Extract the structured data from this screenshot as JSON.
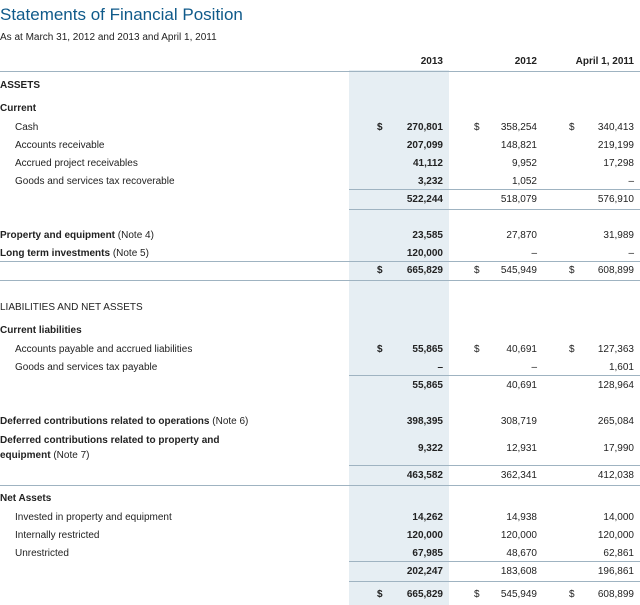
{
  "title": "Statements of Financial Position",
  "subtitle": "As at March 31, 2012 and 2013 and April 1, 2011",
  "columns": [
    "2013",
    "2012",
    "April 1, 2011"
  ],
  "currency_symbol": "$",
  "assets": {
    "heading": "ASSETS",
    "current_heading": "Current",
    "rows": [
      {
        "label": "Cash",
        "values": [
          "270,801",
          "358,254",
          "340,413"
        ]
      },
      {
        "label": "Accounts receivable",
        "values": [
          "207,099",
          "148,821",
          "219,199"
        ]
      },
      {
        "label": "Accrued project receivables",
        "values": [
          "41,112",
          "9,952",
          "17,298"
        ]
      },
      {
        "label": "Goods and services tax recoverable",
        "values": [
          "3,232",
          "1,052",
          "–"
        ]
      }
    ],
    "current_total": [
      "522,244",
      "518,079",
      "576,910"
    ],
    "property_label": "Property and equipment",
    "property_note": "(Note 4)",
    "property_values": [
      "23,585",
      "27,870",
      "31,989"
    ],
    "investments_label": "Long term investments",
    "investments_note": "(Note 5)",
    "investments_values": [
      "120,000",
      "–",
      "–"
    ],
    "total": [
      "665,829",
      "545,949",
      "608,899"
    ]
  },
  "liabilities": {
    "heading": "LIABILITIES AND NET ASSETS",
    "current_heading": "Current liabilities",
    "rows": [
      {
        "label": "Accounts payable and accrued liabilities",
        "values": [
          "55,865",
          "40,691",
          "127,363"
        ]
      },
      {
        "label": "Goods and services tax payable",
        "values": [
          "–",
          "–",
          "1,601"
        ]
      }
    ],
    "current_total": [
      "55,865",
      "40,691",
      "128,964"
    ],
    "deferred_ops_label": "Deferred contributions related to operations",
    "deferred_ops_note": "(Note 6)",
    "deferred_ops_values": [
      "398,395",
      "308,719",
      "265,084"
    ],
    "deferred_prop_label_line1": "Deferred contributions related to property and",
    "deferred_prop_label_line2": "equipment",
    "deferred_prop_note": "(Note 7)",
    "deferred_prop_values": [
      "9,322",
      "12,931",
      "17,990"
    ],
    "total": [
      "463,582",
      "362,341",
      "412,038"
    ]
  },
  "net_assets": {
    "heading": "Net Assets",
    "rows": [
      {
        "label": "Invested in property and equipment",
        "values": [
          "14,262",
          "14,938",
          "14,000"
        ]
      },
      {
        "label": "Internally restricted",
        "values": [
          "120,000",
          "120,000",
          "120,000"
        ]
      },
      {
        "label": "Unrestricted",
        "values": [
          "67,985",
          "48,670",
          "62,861"
        ]
      }
    ],
    "total": [
      "202,247",
      "183,608",
      "196,861"
    ],
    "grand_total": [
      "665,829",
      "545,949",
      "608,899"
    ]
  }
}
